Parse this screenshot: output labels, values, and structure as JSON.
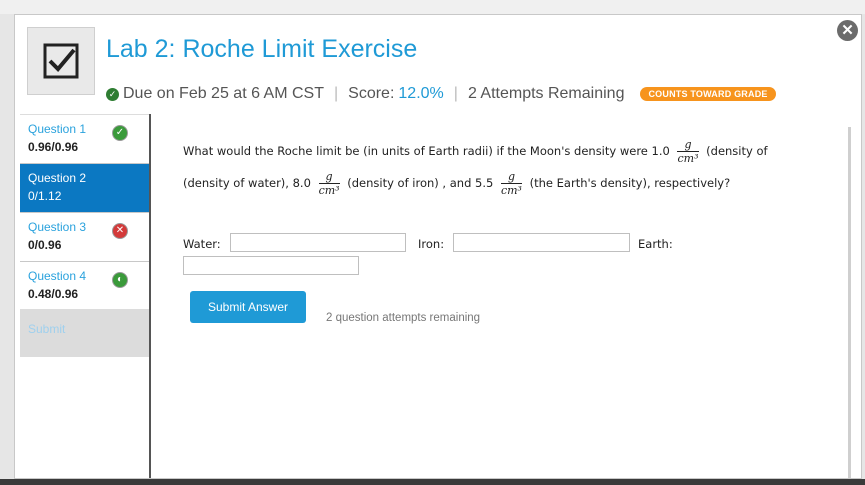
{
  "header": {
    "title": "Lab 2: Roche Limit Exercise",
    "due": "Due on Feb 25 at 6 AM CST",
    "score_label": "Score:",
    "score_value": "12.0%",
    "attempts": "2 Attempts Remaining",
    "badge": "COUNTS TOWARD GRADE",
    "separator": "|"
  },
  "sidebar": {
    "questions": [
      {
        "label": "Question 1",
        "score": "0.96/0.96",
        "status": "correct"
      },
      {
        "label": "Question 2",
        "score": "0/1.12",
        "status": "active"
      },
      {
        "label": "Question 3",
        "score": "0/0.96",
        "status": "incorrect"
      },
      {
        "label": "Question 4",
        "score": "0.48/0.96",
        "status": "partial"
      }
    ],
    "submit_label": "Submit"
  },
  "question": {
    "part1": "What would the Roche limit be (in units of Earth radii) if the Moon's density were 1.0",
    "part2": "(density of water), 8.0",
    "part3": "(density of iron) , and 5.5",
    "part4": "(the Earth's density), respectively?",
    "frac_num": "g",
    "frac_den": "cm³",
    "part1b": "(density of"
  },
  "inputs": {
    "water_label": "Water:",
    "iron_label": "Iron:",
    "earth_label": "Earth:",
    "water_value": "",
    "iron_value": "",
    "earth_value": ""
  },
  "actions": {
    "submit_answer": "Submit Answer",
    "attempts_note": "2 question attempts remaining"
  },
  "colors": {
    "accent": "#1f9ad6",
    "active_bg": "#0b78c2",
    "badge": "#f7941d"
  }
}
